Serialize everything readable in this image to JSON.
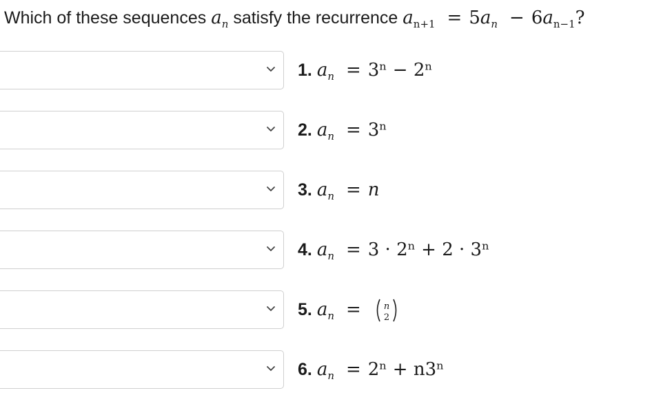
{
  "question": {
    "prefix": "Which of these sequences",
    "seq_var": "a",
    "seq_sub": "n",
    "middle": "satisfy the recurrence",
    "lhs_var": "a",
    "lhs_sub": "n+1",
    "eq": "=",
    "c1": "5",
    "t1_var": "a",
    "t1_sub": "n",
    "minus": "−",
    "c2": "6",
    "t2_var": "a",
    "t2_sub": "n−1",
    "end": "?"
  },
  "options": [
    {
      "number": "1.",
      "var": "a",
      "sub": "n",
      "eq": "=",
      "expr": "3ⁿ − 2ⁿ"
    },
    {
      "number": "2.",
      "var": "a",
      "sub": "n",
      "eq": "=",
      "expr": "3ⁿ"
    },
    {
      "number": "3.",
      "var": "a",
      "sub": "n",
      "eq": "=",
      "expr": "n"
    },
    {
      "number": "4.",
      "var": "a",
      "sub": "n",
      "eq": "=",
      "expr": "3 · 2ⁿ + 2 · 3ⁿ"
    },
    {
      "number": "5.",
      "var": "a",
      "sub": "n",
      "eq": "=",
      "expr_top": "n",
      "expr_bottom": "2"
    },
    {
      "number": "6.",
      "var": "a",
      "sub": "n",
      "eq": "=",
      "expr": "2ⁿ + n3ⁿ"
    }
  ],
  "dropdowns": [
    {
      "selected": ""
    },
    {
      "selected": ""
    },
    {
      "selected": ""
    },
    {
      "selected": ""
    },
    {
      "selected": ""
    },
    {
      "selected": ""
    }
  ],
  "icons": {
    "dropdown": "chevron-down-icon"
  },
  "colors": {
    "border": "#cfcfcf",
    "text": "#1a1a1a",
    "chevron": "#444444"
  }
}
